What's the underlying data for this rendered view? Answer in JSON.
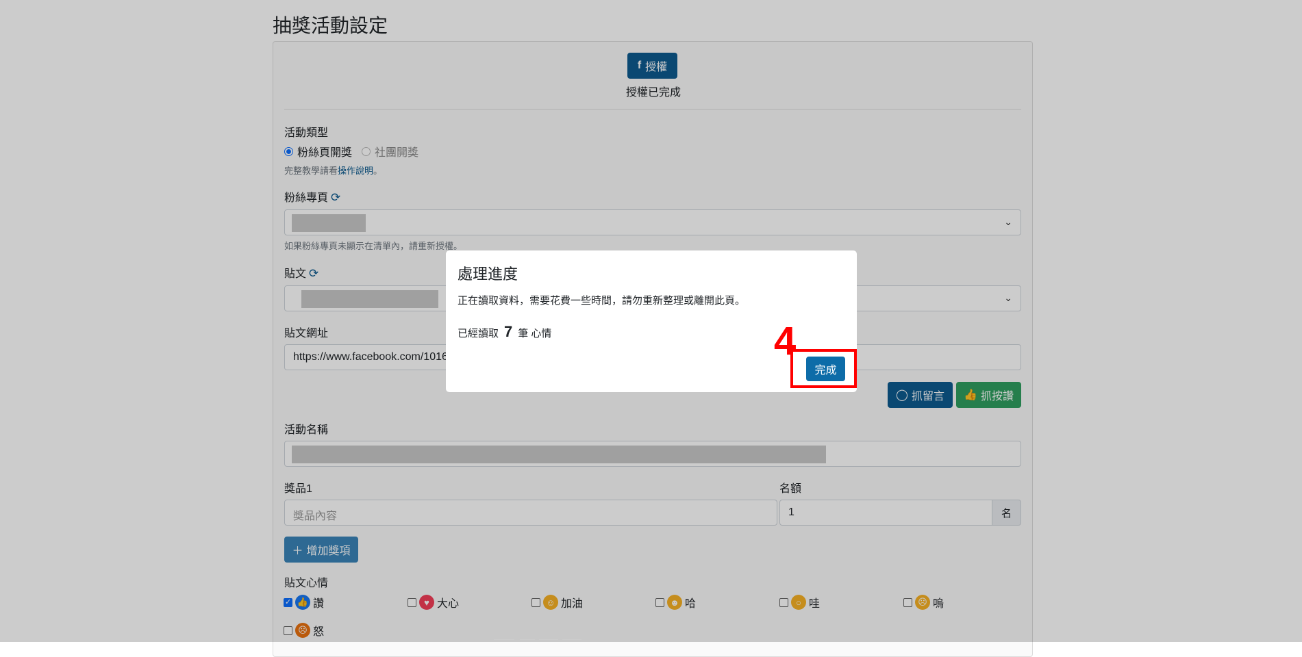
{
  "page": {
    "title": "抽獎活動設定"
  },
  "auth": {
    "button_label": "授權",
    "status": "授權已完成"
  },
  "activity_type": {
    "label": "活動類型",
    "options": [
      {
        "label": "粉絲頁開獎",
        "checked": true
      },
      {
        "label": "社團開獎",
        "checked": false
      }
    ],
    "help_prefix": "完整教學請看",
    "help_link": "操作說明",
    "help_suffix": "。"
  },
  "fanpage": {
    "label": "粉絲專頁",
    "help": "如果粉絲專頁未顯示在清單內，請重新授權。"
  },
  "post": {
    "label": "貼文"
  },
  "post_url": {
    "label": "貼文網址",
    "value": "https://www.facebook.com/1016"
  },
  "actions": {
    "fetch_comments": "抓留言",
    "fetch_likes": "抓按讚"
  },
  "event_name": {
    "label": "活動名稱"
  },
  "prize": {
    "label": "獎品1",
    "placeholder": "獎品內容",
    "quota_label": "名額",
    "quota_value": "1",
    "quota_unit": "名"
  },
  "add_prize": {
    "label": "增加獎項"
  },
  "reactions": {
    "label": "貼文心情",
    "items": [
      {
        "label": "讚",
        "checked": true,
        "color": "#1877f2"
      },
      {
        "label": "大心",
        "checked": false,
        "color": "#f33e58"
      },
      {
        "label": "加油",
        "checked": false,
        "color": "#f7b125"
      },
      {
        "label": "哈",
        "checked": false,
        "color": "#f7b125"
      },
      {
        "label": "哇",
        "checked": false,
        "color": "#f7b125"
      },
      {
        "label": "嗚",
        "checked": false,
        "color": "#f7b125"
      },
      {
        "label": "怒",
        "checked": false,
        "color": "#e9710f"
      }
    ]
  },
  "modal": {
    "title": "處理進度",
    "message": "正在讀取資料，需要花費一些時間，請勿重新整理或離開此頁。",
    "count_prefix": "已經讀取",
    "count": "7",
    "count_suffix": "筆 心情",
    "done_label": "完成"
  },
  "annotation": {
    "step": "4"
  }
}
